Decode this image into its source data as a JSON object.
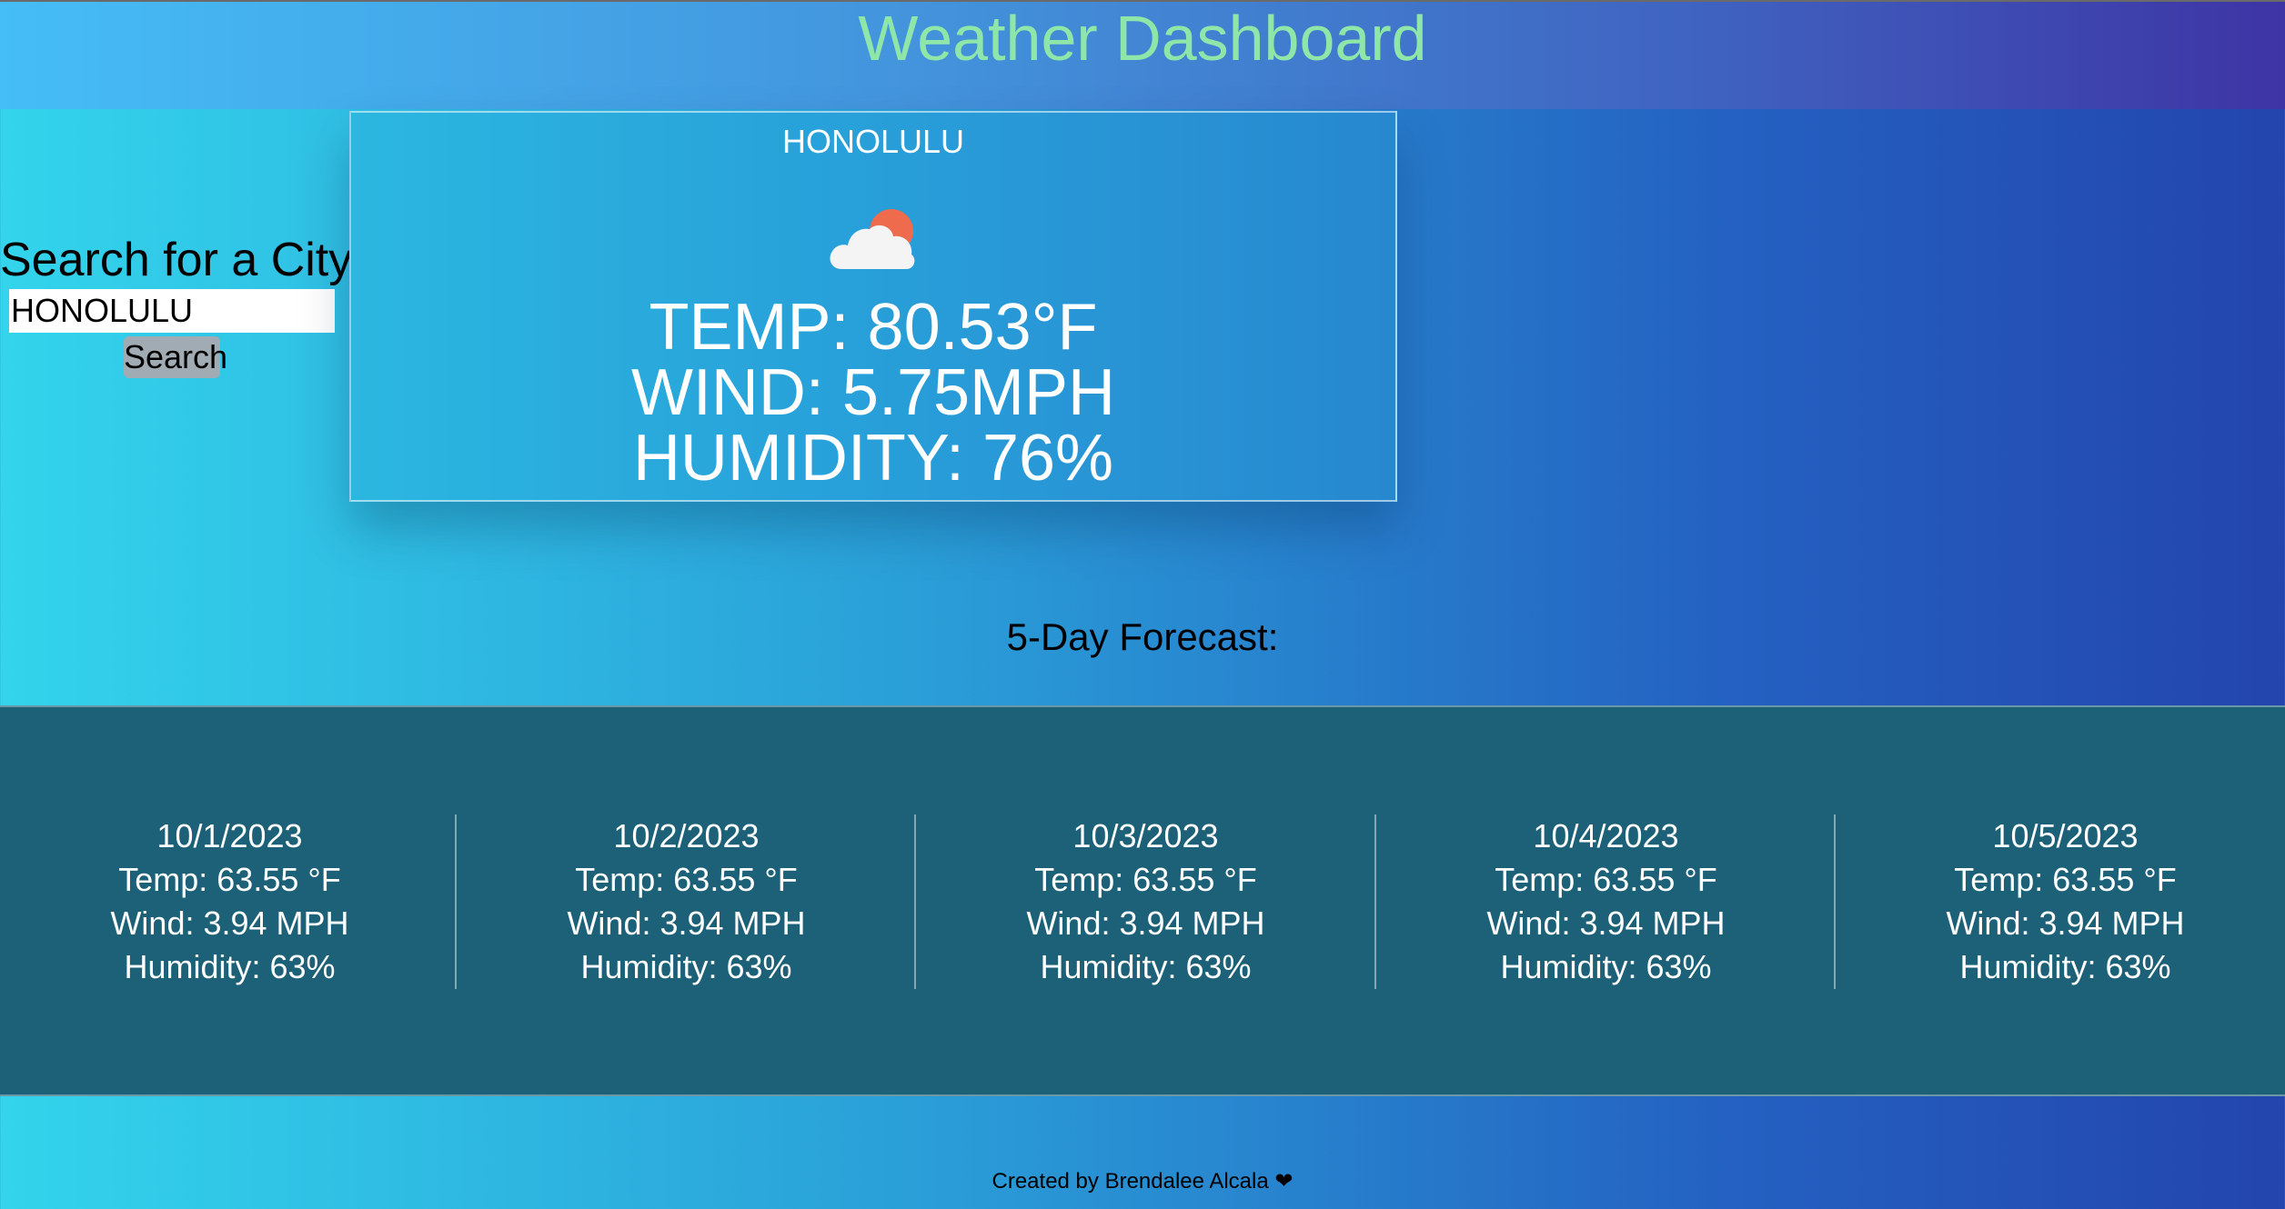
{
  "header": {
    "title": "Weather Dashboard"
  },
  "search": {
    "label": "Search for a City:",
    "input_value": "HONOLULU",
    "button_label": "Search"
  },
  "current": {
    "city": "HONOLULU",
    "icon": "cloud-sun-icon",
    "temp": "TEMP: 80.53°F",
    "wind": "WIND: 5.75MPH",
    "humidity": "HUMIDITY: 76%"
  },
  "forecast": {
    "title": "5-Day Forecast:",
    "days": [
      {
        "date": "10/1/2023",
        "temp": "Temp: 63.55 °F",
        "wind": "Wind: 3.94 MPH",
        "humidity": "Humidity: 63%"
      },
      {
        "date": "10/2/2023",
        "temp": "Temp: 63.55 °F",
        "wind": "Wind: 3.94 MPH",
        "humidity": "Humidity: 63%"
      },
      {
        "date": "10/3/2023",
        "temp": "Temp: 63.55 °F",
        "wind": "Wind: 3.94 MPH",
        "humidity": "Humidity: 63%"
      },
      {
        "date": "10/4/2023",
        "temp": "Temp: 63.55 °F",
        "wind": "Wind: 3.94 MPH",
        "humidity": "Humidity: 63%"
      },
      {
        "date": "10/5/2023",
        "temp": "Temp: 63.55 °F",
        "wind": "Wind: 3.94 MPH",
        "humidity": "Humidity: 63%"
      }
    ]
  },
  "footer": {
    "text": "Created by Brendalee Alcala",
    "icon": "heart-icon"
  },
  "colors": {
    "title": "#8fe6a9",
    "forecast_band": "#1c6178",
    "sun": "#ee6b4d"
  }
}
